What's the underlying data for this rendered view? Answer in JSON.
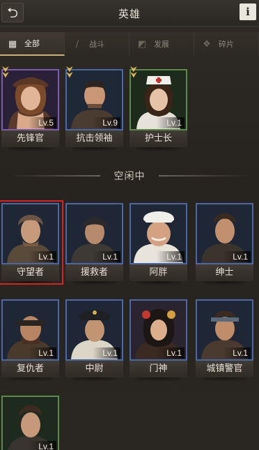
{
  "header": {
    "title": "英雄",
    "back_icon": "back-arrow-icon",
    "info_label": "i"
  },
  "tabs": [
    {
      "label": "全部",
      "icon": "grid-icon",
      "active": true
    },
    {
      "label": "战斗",
      "icon": "knife-icon",
      "active": false
    },
    {
      "label": "发展",
      "icon": "chart-icon",
      "active": false
    },
    {
      "label": "碎片",
      "icon": "puzzle-icon",
      "active": false
    }
  ],
  "assigned_heroes": [
    {
      "name": "先锋官",
      "level": "Lv.5",
      "rarity": "purple",
      "rank_icon": "chevron-rank-icon"
    },
    {
      "name": "抗击领袖",
      "level": "Lv.9",
      "rarity": "blue",
      "rank_icon": "chevron-rank-icon"
    },
    {
      "name": "护士长",
      "level": "Lv.1",
      "rarity": "green",
      "rank_icon": "chevron-rank-icon"
    }
  ],
  "idle_section_label": "空闲中",
  "idle_heroes": [
    {
      "name": "守望者",
      "level": "Lv.1",
      "rarity": "blue",
      "selected": true
    },
    {
      "name": "援救者",
      "level": "Lv.1",
      "rarity": "blue"
    },
    {
      "name": "阿胖",
      "level": "Lv.1",
      "rarity": "blue"
    },
    {
      "name": "绅士",
      "level": "Lv.1",
      "rarity": "blue"
    },
    {
      "name": "复仇者",
      "level": "Lv.1",
      "rarity": "blue"
    },
    {
      "name": "中尉",
      "level": "Lv.1",
      "rarity": "blue"
    },
    {
      "name": "门神",
      "level": "Lv.1",
      "rarity": "blue"
    },
    {
      "name": "城镇警官",
      "level": "Lv.1",
      "rarity": "blue"
    },
    {
      "name": "",
      "level": "Lv.1",
      "rarity": "green"
    }
  ],
  "colors": {
    "rarity_blue": "#4b67a8",
    "rarity_purple": "#7b5bb4",
    "rarity_green": "#5b8a4a",
    "selection": "#d62222",
    "rank_gold": "#d9b553"
  }
}
